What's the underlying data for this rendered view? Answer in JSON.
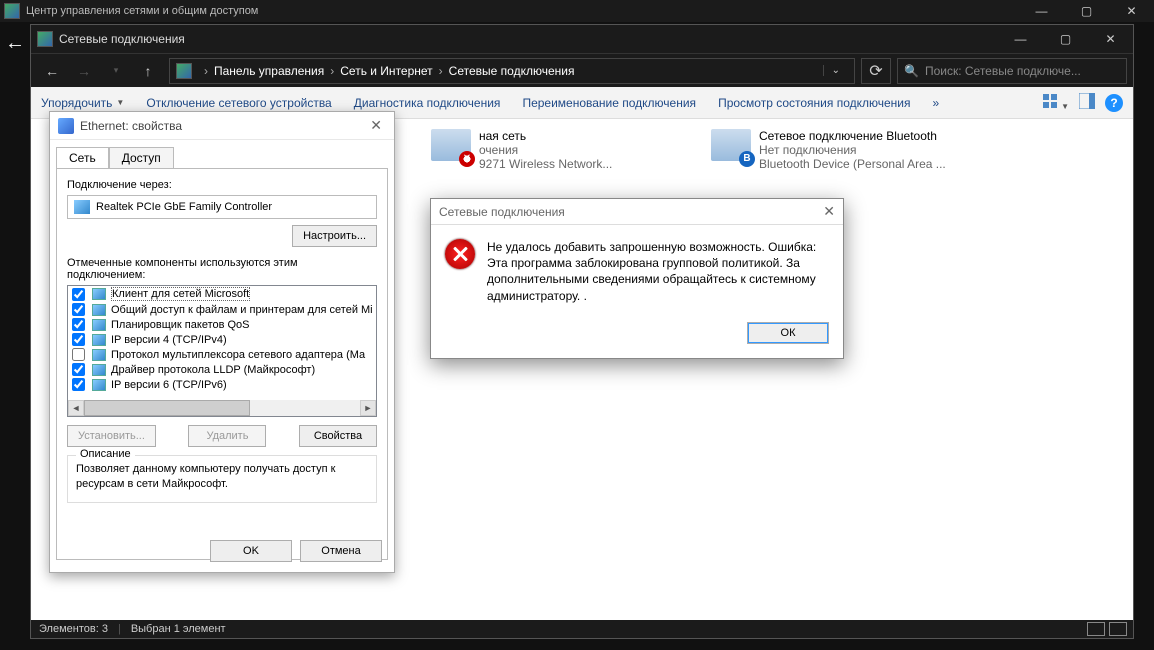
{
  "outer": {
    "title": "Центр управления сетями и общим доступом"
  },
  "outer_left_arrow": "←",
  "inner": {
    "title": "Сетевые подключения"
  },
  "breadcrumb": {
    "sep": "›",
    "items": [
      "Панель управления",
      "Сеть и Интернет",
      "Сетевые подключения"
    ]
  },
  "search": {
    "placeholder": "Поиск: Сетевые подключе..."
  },
  "toolbar": {
    "organize": "Упорядочить",
    "disable": "Отключение сетевого устройства",
    "diagnose": "Диагностика подключения",
    "rename": "Переименование подключения",
    "status": "Просмотр состояния подключения",
    "more": "»"
  },
  "connections": [
    {
      "name": "ная сеть",
      "state": "очения",
      "adapter": "9271 Wireless Network...",
      "iconClass": "x"
    },
    {
      "name": "Сетевое подключение Bluetooth",
      "state": "Нет подключения",
      "adapter": "Bluetooth Device (Personal Area ...",
      "iconClass": "bt"
    }
  ],
  "statusbar": {
    "count_label": "Элементов: 3",
    "selection_label": "Выбран 1 элемент"
  },
  "props": {
    "title": "Ethernet: свойства",
    "tabs": {
      "net": "Сеть",
      "access": "Доступ"
    },
    "connect_via_label": "Подключение через:",
    "adapter": "Realtek PCIe GbE Family Controller",
    "configure": "Настроить...",
    "components_label": "Отмеченные компоненты используются этим подключением:",
    "components": [
      {
        "checked": true,
        "label": "Клиент для сетей Microsoft",
        "selected": true
      },
      {
        "checked": true,
        "label": "Общий доступ к файлам и принтерам для сетей Mi"
      },
      {
        "checked": true,
        "label": "Планировщик пакетов QoS"
      },
      {
        "checked": true,
        "label": "IP версии 4 (TCP/IPv4)"
      },
      {
        "checked": false,
        "label": "Протокол мультиплексора сетевого адаптера (Ма"
      },
      {
        "checked": true,
        "label": "Драйвер протокола LLDP (Майкрософт)"
      },
      {
        "checked": true,
        "label": "IP версии 6 (TCP/IPv6)"
      }
    ],
    "install": "Установить...",
    "uninstall": "Удалить",
    "properties": "Свойства",
    "desc_legend": "Описание",
    "desc_text": "Позволяет данному компьютеру получать доступ к ресурсам в сети Майкрософт.",
    "ok": "OK",
    "cancel": "Отмена"
  },
  "err": {
    "title": "Сетевые подключения",
    "text": "Не удалось добавить запрошенную возможность. Ошибка: Эта программа заблокирована групповой политикой. За дополнительными сведениями обращайтесь к системному администратору.\n.",
    "ok": "ОК"
  }
}
